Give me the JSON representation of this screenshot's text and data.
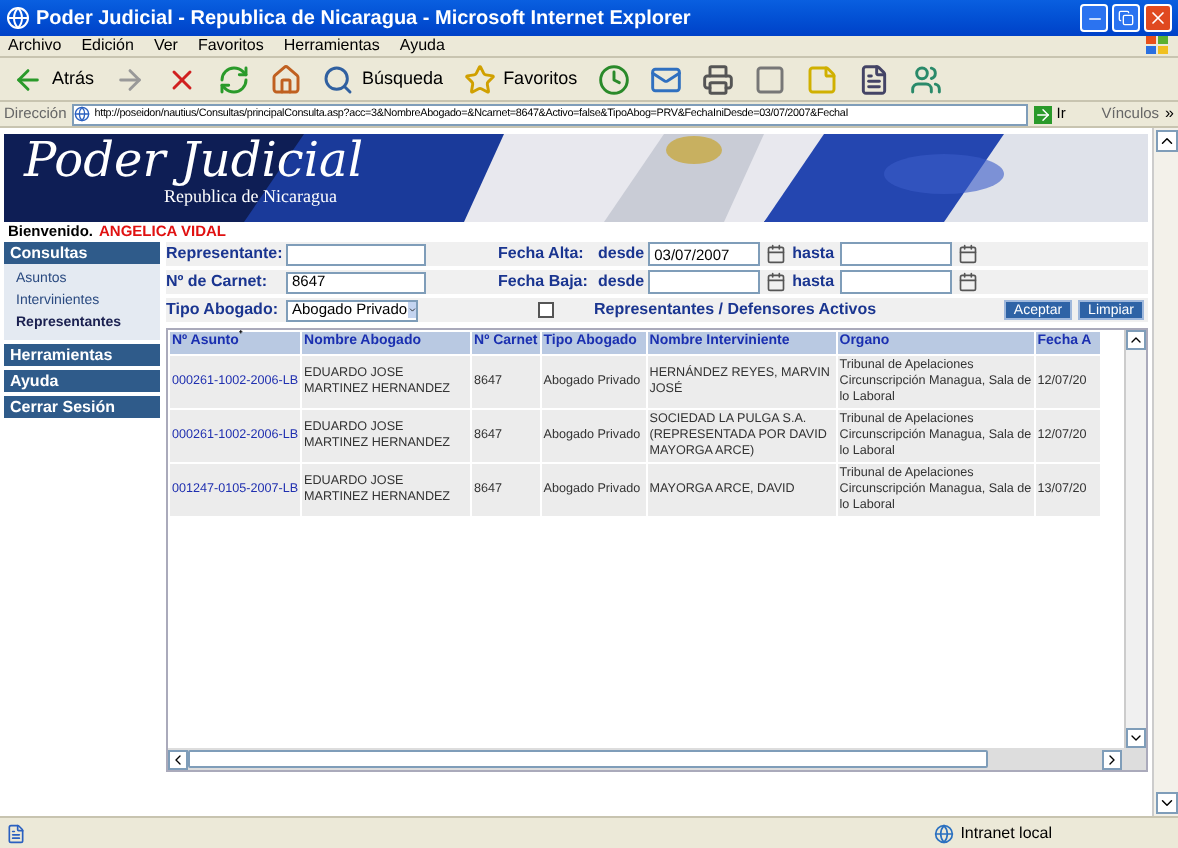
{
  "window": {
    "title": "Poder Judicial - Republica de Nicaragua - Microsoft Internet Explorer"
  },
  "menu": [
    "Archivo",
    "Edición",
    "Ver",
    "Favoritos",
    "Herramientas",
    "Ayuda"
  ],
  "toolbar": {
    "back": "Atrás",
    "search": "Búsqueda",
    "favorites": "Favoritos"
  },
  "address": {
    "label": "Dirección",
    "url": "http://poseidon/nautius/Consultas/principalConsulta.asp?acc=3&NombreAbogado=&Ncarnet=8647&Activo=false&TipoAbog=PRV&FechaIniDesde=03/07/2007&FechaI",
    "go": "Ir",
    "links": "Vínculos",
    "more": "»"
  },
  "banner": {
    "title": "Poder Judicial",
    "subtitle": "Republica de Nicaragua"
  },
  "welcome": {
    "label": "Bienvenido.",
    "user": "ANGELICA VIDAL"
  },
  "sidebar": [
    {
      "label": "Consultas",
      "children": [
        {
          "label": "Asuntos",
          "selected": false
        },
        {
          "label": "Intervinientes",
          "selected": false
        },
        {
          "label": "Representantes",
          "selected": true
        }
      ]
    },
    {
      "label": "Herramientas"
    },
    {
      "label": "Ayuda"
    },
    {
      "label": "Cerrar Sesión"
    }
  ],
  "form": {
    "representante": {
      "label": "Representante:"
    },
    "carnet": {
      "label": "Nº de Carnet:",
      "value": "8647"
    },
    "tipo": {
      "label": "Tipo Abogado:",
      "value": "Abogado Privado"
    },
    "fecha_alta": {
      "label": "Fecha Alta:",
      "from_label": "desde",
      "from": "03/07/2007",
      "to_label": "hasta"
    },
    "fecha_baja": {
      "label": "Fecha Baja:",
      "from_label": "desde",
      "to_label": "hasta"
    },
    "activos": {
      "label": "Representantes / Defensores Activos",
      "checked": false
    },
    "buttons": [
      "Aceptar",
      "Limpiar"
    ]
  },
  "table": {
    "columns": [
      {
        "label": "Nº Asunto",
        "sort_mark": "⁺",
        "kind": "link"
      },
      {
        "label": "Nombre Abogado",
        "kind": "text"
      },
      {
        "label": "Nº Carnet",
        "kind": "text"
      },
      {
        "label": "Tipo Abogado",
        "kind": "text"
      },
      {
        "label": "Nombre Interviniente",
        "kind": "text"
      },
      {
        "label": "Organo",
        "kind": "text"
      },
      {
        "label": "Fecha A",
        "kind": "text"
      }
    ],
    "rows": [
      [
        "000261-1002-2006-LB",
        "EDUARDO JOSE MARTINEZ HERNANDEZ",
        "8647",
        "Abogado Privado",
        "HERNÁNDEZ REYES, MARVIN JOSÉ",
        "Tribunal de Apelaciones Circunscripción Managua, Sala de lo Laboral",
        "12/07/20"
      ],
      [
        "000261-1002-2006-LB",
        "EDUARDO JOSE MARTINEZ HERNANDEZ",
        "8647",
        "Abogado Privado",
        "SOCIEDAD LA PULGA S.A. (REPRESENTADA POR DAVID MAYORGA ARCE)",
        "Tribunal de Apelaciones Circunscripción Managua, Sala de lo Laboral",
        "12/07/20"
      ],
      [
        "001247-0105-2007-LB",
        "EDUARDO JOSE MARTINEZ HERNANDEZ",
        "8647",
        "Abogado Privado",
        "MAYORGA ARCE, DAVID",
        "Tribunal de Apelaciones Circunscripción Managua, Sala de lo Laboral",
        "13/07/20"
      ]
    ]
  },
  "status_bar": {
    "zone": "Intranet local"
  }
}
